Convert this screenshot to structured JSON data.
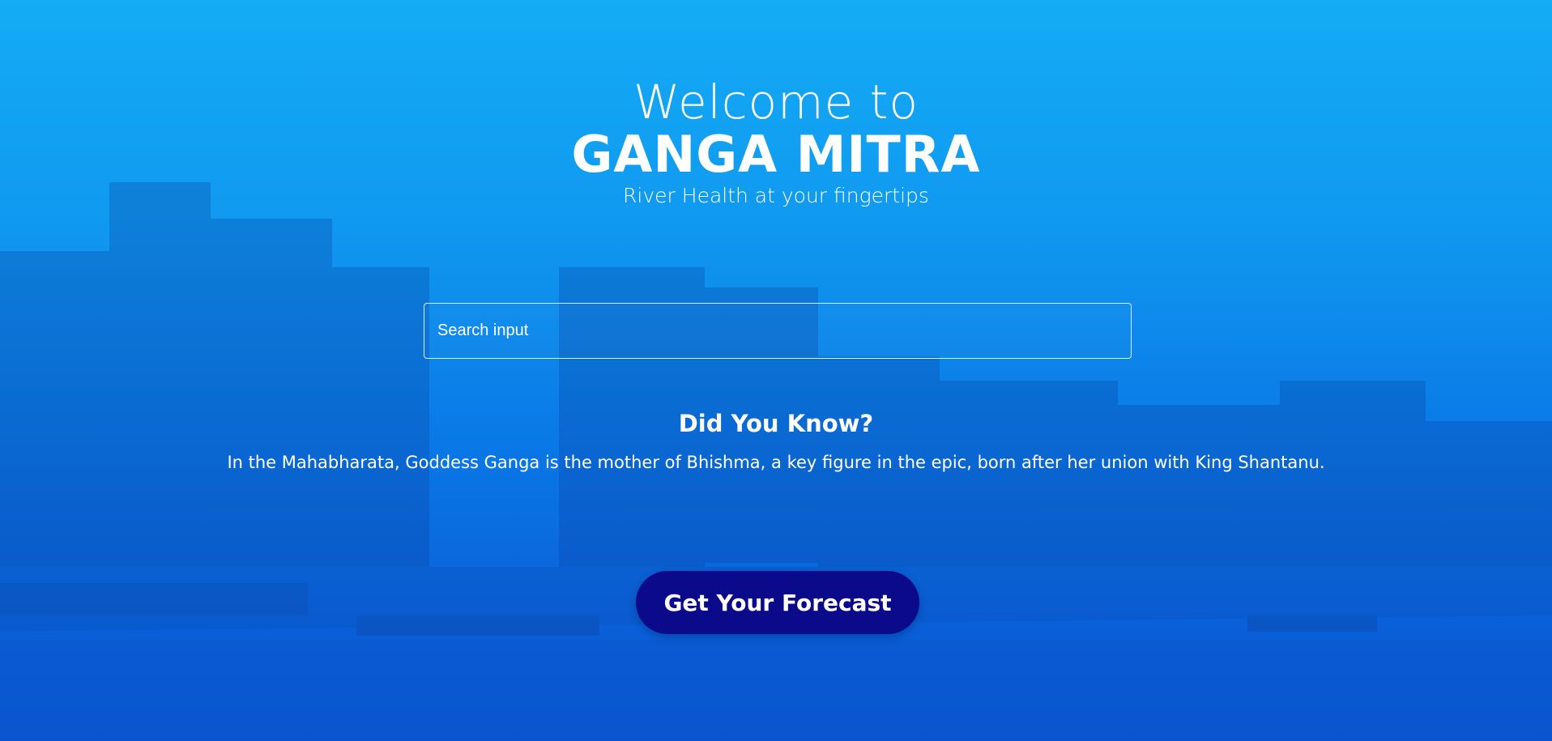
{
  "hero": {
    "welcome": "Welcome to",
    "brand": "GANGA MITRA",
    "tagline": "River Health at your fingertips"
  },
  "search": {
    "placeholder": "Search input",
    "value": ""
  },
  "fact": {
    "title": "Did You Know?",
    "text": "In the Mahabharata, Goddess Ganga is the mother of Bhishma, a key figure in the epic, born after her union with King Shantanu."
  },
  "cta": {
    "label": "Get Your Forecast"
  },
  "colors": {
    "background_top": "#14acf5",
    "background_bottom": "#0b56d2",
    "button": "#0b0a8a",
    "text": "#ffffff"
  }
}
